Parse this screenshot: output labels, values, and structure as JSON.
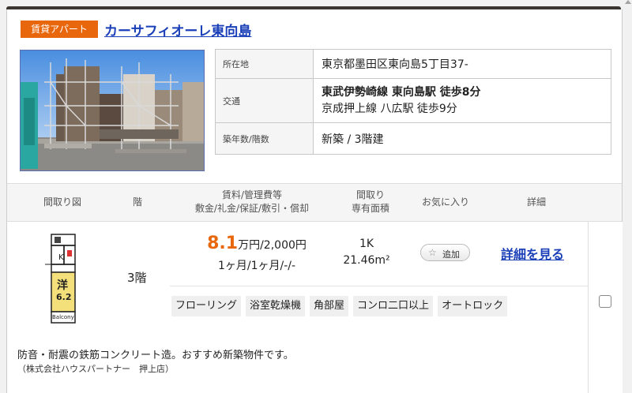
{
  "listing": {
    "category_badge": "賃貸アパート",
    "building_name": "カーサフィオーレ東向島"
  },
  "info": {
    "address_label": "所在地",
    "address_value": "東京都墨田区東向島5丁目37-",
    "access_label": "交通",
    "access_line1": "東武伊勢崎線 東向島駅 徒歩8分",
    "access_line2": "京成押上線 八広駅 徒歩9分",
    "age_label": "築年数/階数",
    "age_value": "新築 / 3階建"
  },
  "table_header": {
    "floorplan": "間取り図",
    "floor": "階",
    "rent_line1": "賃料/管理費等",
    "rent_line2": "敷金/礼金/保証/敷引・償却",
    "layout_line1": "間取り",
    "layout_line2": "専有面積",
    "favorite": "お気に入り",
    "detail": "詳細"
  },
  "room": {
    "floor": "3階",
    "rent_number": "8.1",
    "rent_suffix": "万円/2,000円",
    "deposit": "1ヶ月/1ヶ月/-/-",
    "layout": "1K",
    "area": "21.46m²",
    "fav_button": "追加",
    "detail_link": "詳細を見る",
    "tags": [
      "フローリング",
      "浴室乾燥機",
      "角部屋",
      "コンロ二口以上",
      "オートロック"
    ],
    "plan_labels": {
      "k": "K",
      "yo": "洋",
      "size": "6.2",
      "balcony": "Balcony"
    }
  },
  "comment": "防音・耐震の鉄筋コンクリート造。おすすめ新築物件です。",
  "company": "（株式会社ハウスパートナー　押上店）",
  "colors": {
    "accent": "#e8670c",
    "link": "#1a3fb8"
  }
}
